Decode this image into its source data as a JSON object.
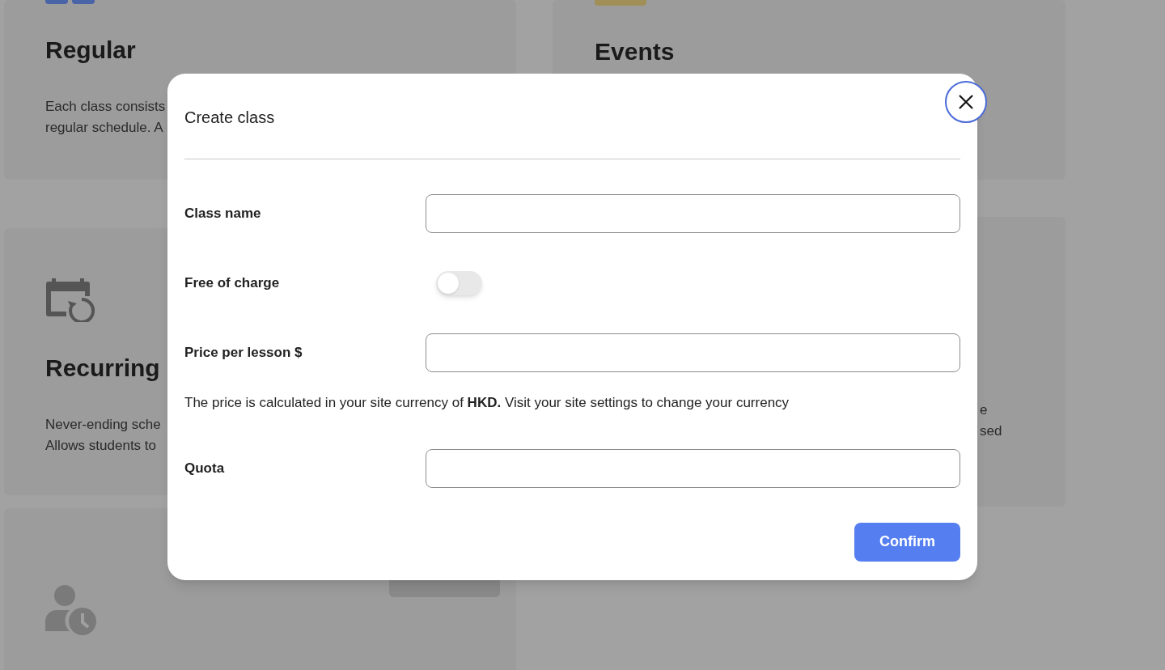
{
  "background": {
    "left_cards": [
      {
        "kind": "regular",
        "title": "Regular",
        "lines": [
          "Each class consists",
          "regular schedule. A"
        ]
      },
      {
        "kind": "recurring",
        "title": "Recurring",
        "lines": [
          "Never-ending sche",
          "Allows students to"
        ]
      },
      {
        "kind": "appointment",
        "badge": true
      }
    ],
    "right_cards": [
      {
        "kind": "events",
        "title": "Events"
      },
      {
        "kind": "text",
        "lines": [
          "e",
          "sed"
        ]
      }
    ]
  },
  "dialog": {
    "title": "Create class",
    "fields": [
      {
        "kind": "text",
        "label": "Class name"
      },
      {
        "kind": "toggle",
        "label": "Free of charge",
        "on": false
      },
      {
        "kind": "text",
        "label": "Price per lesson $"
      },
      {
        "kind": "note",
        "text": "The price is calculated in your site currency of **HKD.** Visit your site settings to change your currency"
      },
      {
        "kind": "text",
        "label": "Quota"
      }
    ],
    "confirm": "Confirm"
  }
}
